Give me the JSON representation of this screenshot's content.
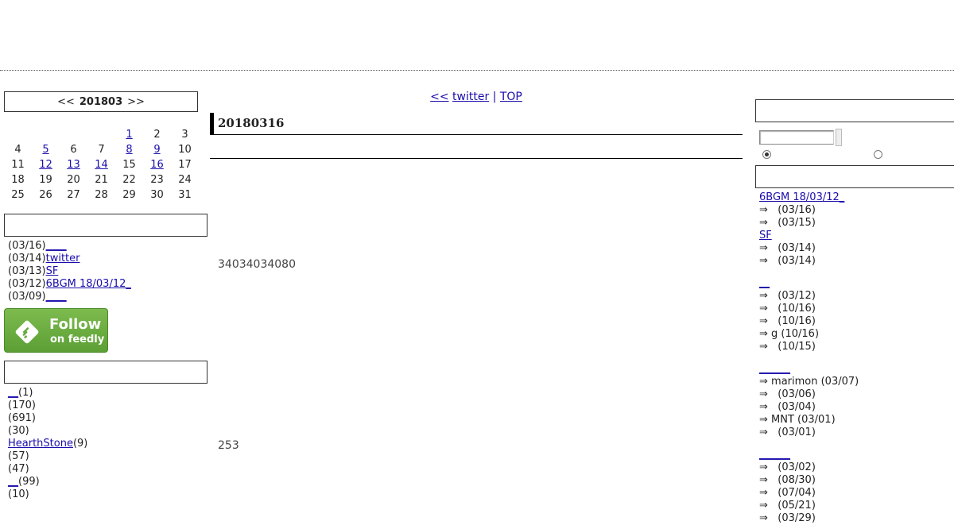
{
  "calendar": {
    "prev": "<<",
    "month": "201803",
    "next": ">>",
    "weeks": [
      [
        "",
        "",
        "",
        "",
        "1",
        "2",
        "3"
      ],
      [
        "4",
        "5",
        "6",
        "7",
        "8",
        "9",
        "10"
      ],
      [
        "11",
        "12",
        "13",
        "14",
        "15",
        "16",
        "17"
      ],
      [
        "18",
        "19",
        "20",
        "21",
        "22",
        "23",
        "24"
      ],
      [
        "25",
        "26",
        "27",
        "28",
        "29",
        "30",
        "31"
      ]
    ],
    "linked_days": [
      "1",
      "5",
      "8",
      "9",
      "12",
      "13",
      "14",
      "16"
    ]
  },
  "recent_posts": [
    {
      "date": "(03/16)",
      "title": "____"
    },
    {
      "date": "(03/14)",
      "title": "twitter"
    },
    {
      "date": "(03/13)",
      "title": "SF"
    },
    {
      "date": "(03/12)",
      "title": "6BGM 18/03/12_"
    },
    {
      "date": "(03/09)",
      "title": "____"
    }
  ],
  "feedly": {
    "line1": "Follow",
    "line2": "on feedly"
  },
  "categories": [
    {
      "name": "__",
      "count": "(1)"
    },
    {
      "name": "",
      "count": "(170)"
    },
    {
      "name": "",
      "count": "(691)"
    },
    {
      "name": "",
      "count": "(30)"
    },
    {
      "name": "HearthStone",
      "count": "(9)"
    },
    {
      "name": "",
      "count": "(57)"
    },
    {
      "name": "",
      "count": "(47)"
    },
    {
      "name": "__",
      "count": "(99)"
    },
    {
      "name": "",
      "count": "(10)"
    }
  ],
  "nav": {
    "prev": "<<",
    "prev_title": "twitter",
    "sep": "|",
    "top": "TOP"
  },
  "post": {
    "title": "20180316",
    "text1": "34034034080",
    "text2": "253"
  },
  "search": {
    "placeholder": ""
  },
  "comments": [
    {
      "type": "link",
      "text": "6BGM 18/03/12_"
    },
    {
      "type": "item",
      "text": "⇒   (03/16)"
    },
    {
      "type": "item",
      "text": "⇒   (03/15)"
    },
    {
      "type": "link",
      "text": "SF"
    },
    {
      "type": "item",
      "text": "⇒   (03/14)"
    },
    {
      "type": "item",
      "text": "⇒   (03/14)"
    },
    {
      "type": "link",
      "text": "__"
    },
    {
      "type": "item",
      "text": "⇒   (03/12)"
    },
    {
      "type": "item",
      "text": "⇒   (10/16)"
    },
    {
      "type": "item",
      "text": "⇒   (10/16)"
    },
    {
      "type": "item",
      "text": "⇒ g (10/16)"
    },
    {
      "type": "item",
      "text": "⇒   (10/15)"
    },
    {
      "type": "link",
      "text": "______"
    },
    {
      "type": "item",
      "text": "⇒ marimon (03/07)"
    },
    {
      "type": "item",
      "text": "⇒   (03/06)"
    },
    {
      "type": "item",
      "text": "⇒   (03/04)"
    },
    {
      "type": "item",
      "text": "⇒ MNT (03/01)"
    },
    {
      "type": "item",
      "text": "⇒   (03/01)"
    },
    {
      "type": "link",
      "text": "______"
    },
    {
      "type": "item",
      "text": "⇒   (03/02)"
    },
    {
      "type": "item",
      "text": "⇒   (08/30)"
    },
    {
      "type": "item",
      "text": "⇒   (07/04)"
    },
    {
      "type": "item",
      "text": "⇒   (05/21)"
    },
    {
      "type": "item",
      "text": "⇒   (03/29)"
    }
  ]
}
